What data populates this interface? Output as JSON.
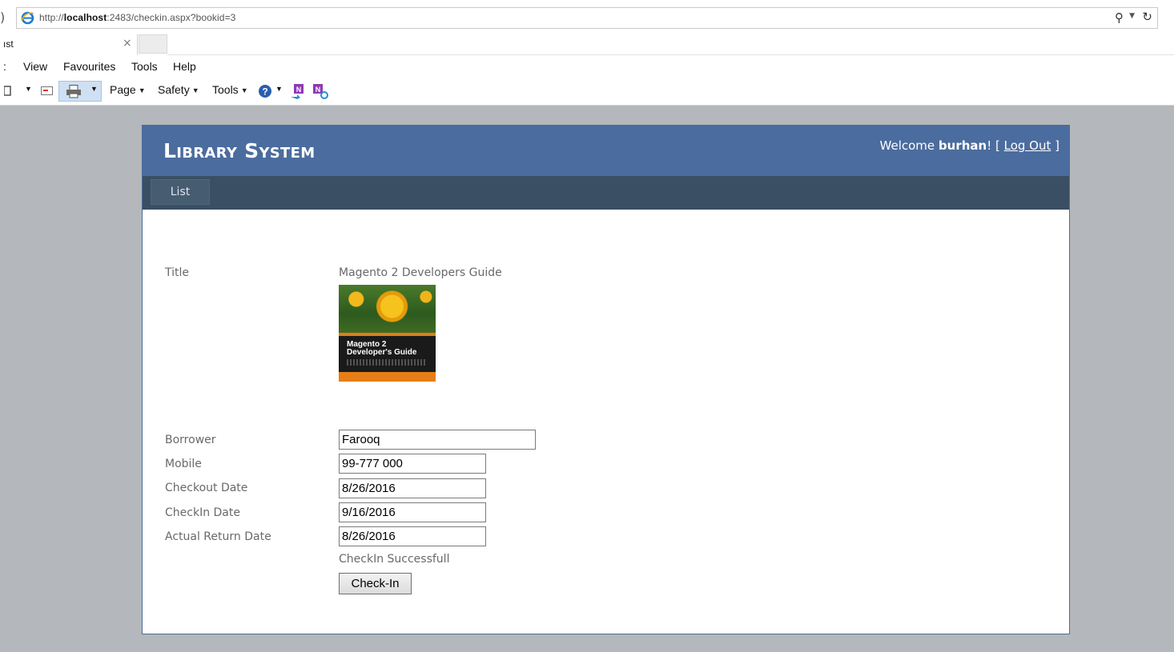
{
  "browser": {
    "back_edge": ")",
    "url_prefix": "http://",
    "url_host": "localhost",
    "url_rest": ":2483/checkin.aspx?bookid=3",
    "tab_title": "ıst",
    "menu": [
      "View",
      "Favourites",
      "Tools",
      "Help"
    ],
    "menu_edge": ":",
    "commands": {
      "page": "Page",
      "safety": "Safety",
      "tools": "Tools"
    }
  },
  "site": {
    "title": "Library System",
    "welcome_prefix": "Welcome ",
    "username": "burhan",
    "welcome_mid": "! [ ",
    "logout_label": "Log Out",
    "welcome_suffix": " ]",
    "nav": {
      "list_label": "List"
    }
  },
  "book": {
    "title_label": "Title",
    "title_value": "Magento 2 Developers Guide",
    "cover_text_line1": "Magento 2",
    "cover_text_line2": "Developer's Guide"
  },
  "form": {
    "borrower_label": "Borrower",
    "borrower_value": "Farooq",
    "mobile_label": "Mobile",
    "mobile_value": "99-777 000",
    "checkout_label": "Checkout Date",
    "checkout_value": "8/26/2016",
    "checkin_label": "CheckIn Date",
    "checkin_value": "9/16/2016",
    "actual_return_label": "Actual Return Date",
    "actual_return_value": "8/26/2016",
    "status_message": "CheckIn Successfull",
    "submit_label": "Check-In"
  }
}
